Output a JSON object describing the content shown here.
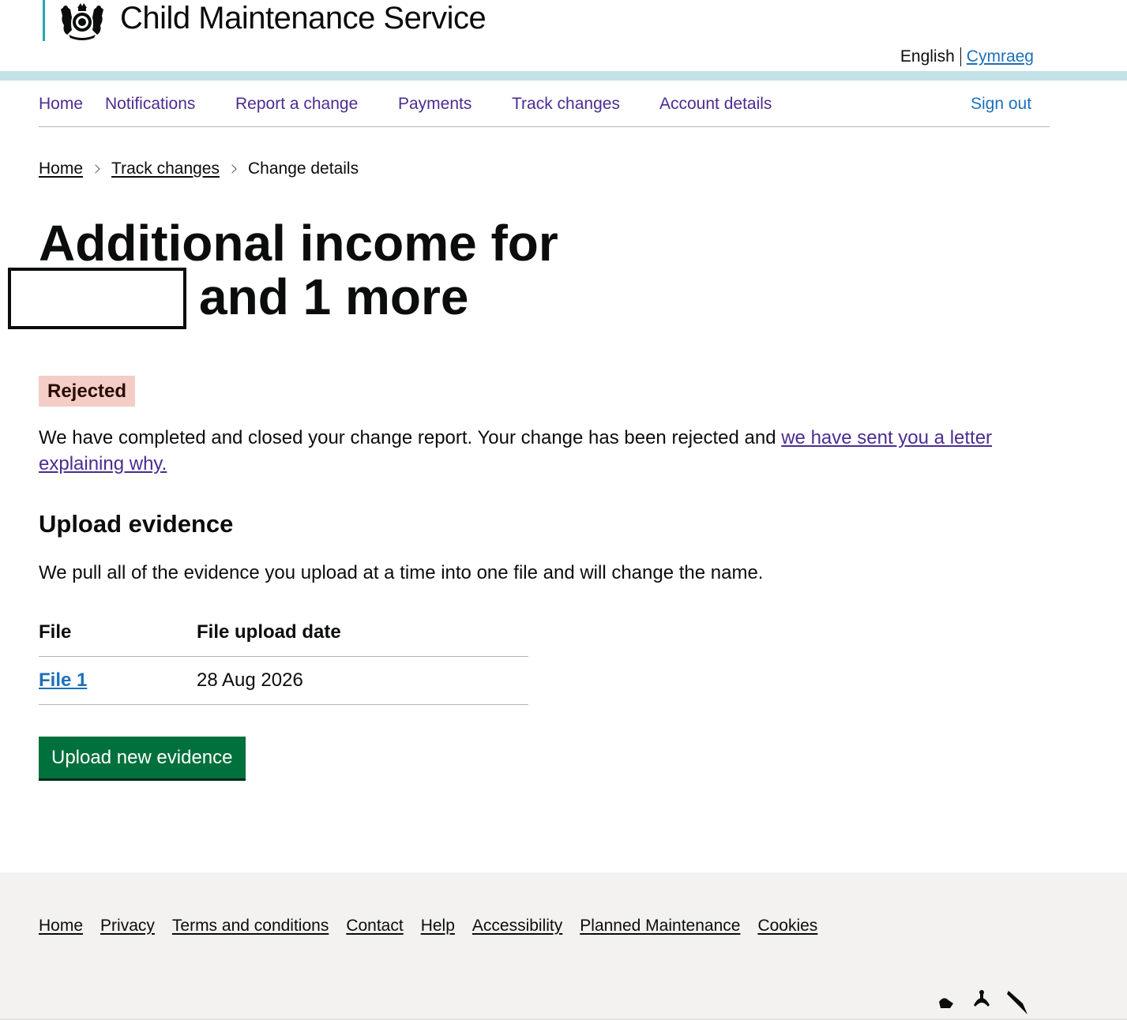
{
  "header": {
    "service_name": "Child Maintenance Service",
    "crest_icon": "royal-coat-of-arms-icon",
    "language": {
      "current": "English",
      "other": "Cymraeg"
    }
  },
  "nav": {
    "items": [
      {
        "label": "Home"
      },
      {
        "label": "Notifications"
      },
      {
        "label": "Report a change"
      },
      {
        "label": "Payments"
      },
      {
        "label": "Track changes"
      },
      {
        "label": "Account details"
      }
    ],
    "sign_out": "Sign out"
  },
  "breadcrumb": {
    "items": [
      {
        "label": "Home"
      },
      {
        "label": "Track changes"
      }
    ],
    "current": "Change details"
  },
  "page": {
    "title_line1": "Additional income for",
    "title_line2": "and 1 more",
    "status": "Rejected",
    "status_color": "#f4cdc6",
    "message": "We have completed and closed your change report. Your change has been rejected and ",
    "message_link": "we have sent you a letter explaining why."
  },
  "evidence": {
    "heading": "Upload evidence",
    "description": "We pull all of the evidence you upload at a time into one file and will change the name.",
    "columns": [
      "File",
      "File upload date"
    ],
    "rows": [
      {
        "file": "File 1",
        "date": "28 Aug 2026"
      }
    ],
    "button": "Upload new evidence"
  },
  "footer": {
    "links": [
      "Home",
      "Privacy",
      "Terms and conditions",
      "Contact",
      "Help",
      "Accessibility",
      "Planned Maintenance",
      "Cookies"
    ]
  },
  "colors": {
    "link": "#4c2c92",
    "link_blue": "#1d70b8",
    "button": "#00703c",
    "header_bar": "#c3e2e7"
  }
}
